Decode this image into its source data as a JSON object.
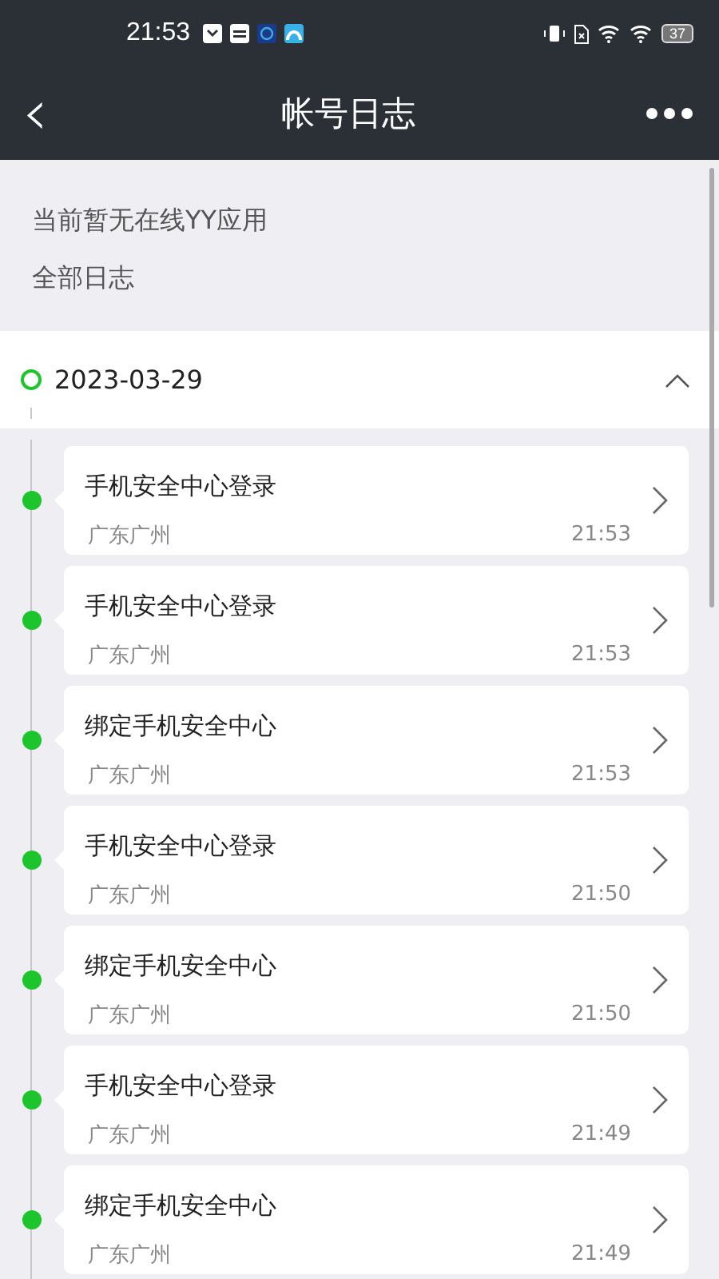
{
  "status_bar": {
    "time": "21:53",
    "battery": "37"
  },
  "header": {
    "back": "‹",
    "title": "帐号日志"
  },
  "notice": "当前暂无在线YY应用",
  "section_title": "全部日志",
  "log_group": {
    "date": "2023-03-29",
    "expanded": true,
    "entries": [
      {
        "title": "手机安全中心登录",
        "location": "广东广州",
        "time": "21:53"
      },
      {
        "title": "手机安全中心登录",
        "location": "广东广州",
        "time": "21:53"
      },
      {
        "title": "绑定手机安全中心",
        "location": "广东广州",
        "time": "21:53"
      },
      {
        "title": "手机安全中心登录",
        "location": "广东广州",
        "time": "21:50"
      },
      {
        "title": "绑定手机安全中心",
        "location": "广东广州",
        "time": "21:50"
      },
      {
        "title": "手机安全中心登录",
        "location": "广东广州",
        "time": "21:49"
      },
      {
        "title": "绑定手机安全中心",
        "location": "广东广州",
        "time": "21:49"
      }
    ]
  }
}
